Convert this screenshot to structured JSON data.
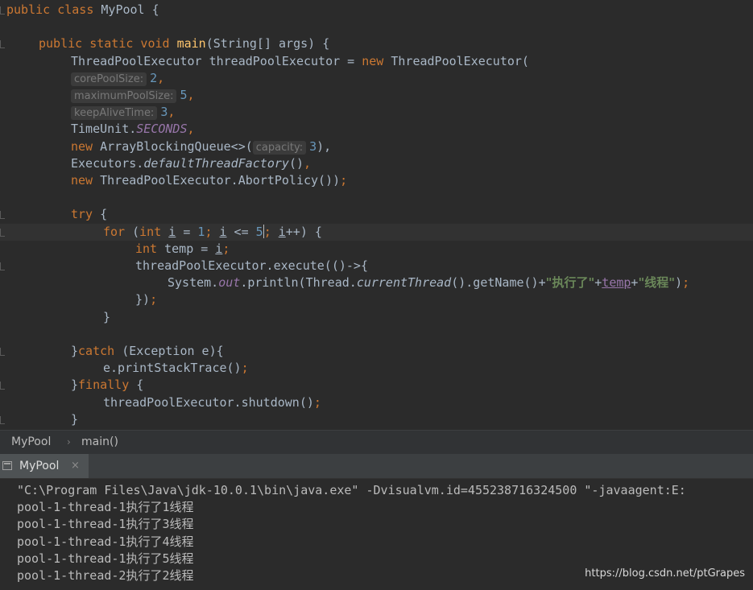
{
  "breadcrumb": {
    "class_name": "MyPool",
    "method_name": "main()"
  },
  "run_tab": {
    "label": "MyPool",
    "close": "×"
  },
  "code_lines": [
    {
      "indent": 0,
      "tokens": [
        {
          "t": "public class ",
          "c": "kw"
        },
        {
          "t": "MyPool {",
          "c": ""
        }
      ]
    },
    {
      "indent": 0,
      "tokens": []
    },
    {
      "indent": 1,
      "tokens": [
        {
          "t": "public static void ",
          "c": "kw"
        },
        {
          "t": "main",
          "c": "fn"
        },
        {
          "t": "(String[] args) {",
          "c": ""
        }
      ]
    },
    {
      "indent": 2,
      "tokens": [
        {
          "t": "ThreadPoolExecutor threadPoolExecutor = ",
          "c": ""
        },
        {
          "t": "new ",
          "c": "kw"
        },
        {
          "t": "ThreadPoolExecutor(",
          "c": ""
        }
      ]
    },
    {
      "indent": 2,
      "tokens": [
        {
          "t": "corePoolSize:",
          "c": "hint"
        },
        {
          "t": "2",
          "c": "num"
        },
        {
          "t": ",",
          "c": "kw"
        }
      ]
    },
    {
      "indent": 2,
      "tokens": [
        {
          "t": "maximumPoolSize:",
          "c": "hint"
        },
        {
          "t": "5",
          "c": "num"
        },
        {
          "t": ",",
          "c": "kw"
        }
      ]
    },
    {
      "indent": 2,
      "tokens": [
        {
          "t": "keepAliveTime:",
          "c": "hint"
        },
        {
          "t": "3",
          "c": "num"
        },
        {
          "t": ",",
          "c": "kw"
        }
      ]
    },
    {
      "indent": 2,
      "tokens": [
        {
          "t": "TimeUnit.",
          "c": ""
        },
        {
          "t": "SECONDS",
          "c": "stat"
        },
        {
          "t": ",",
          "c": "kw"
        }
      ]
    },
    {
      "indent": 2,
      "tokens": [
        {
          "t": "new ",
          "c": "kw"
        },
        {
          "t": "ArrayBlockingQueue<>(",
          "c": ""
        },
        {
          "t": "capacity:",
          "c": "hint"
        },
        {
          "t": "3",
          "c": "num"
        },
        {
          "t": "),",
          "c": ""
        }
      ]
    },
    {
      "indent": 2,
      "tokens": [
        {
          "t": "Executors.",
          "c": ""
        },
        {
          "t": "defaultThreadFactory",
          "c": "ital"
        },
        {
          "t": "()",
          "c": ""
        },
        {
          "t": ",",
          "c": "kw"
        }
      ]
    },
    {
      "indent": 2,
      "tokens": [
        {
          "t": "new ",
          "c": "kw"
        },
        {
          "t": "ThreadPoolExecutor.AbortPolicy())",
          "c": ""
        },
        {
          "t": ";",
          "c": "kw"
        }
      ]
    },
    {
      "indent": 0,
      "tokens": []
    },
    {
      "indent": 2,
      "tokens": [
        {
          "t": "try ",
          "c": "kw"
        },
        {
          "t": "{",
          "c": ""
        }
      ]
    },
    {
      "indent": 3,
      "tokens": [
        {
          "t": "for ",
          "c": "kw"
        },
        {
          "t": "(",
          "c": ""
        },
        {
          "t": "int ",
          "c": "kw"
        },
        {
          "t": "i",
          "c": "var-u"
        },
        {
          "t": " = ",
          "c": ""
        },
        {
          "t": "1",
          "c": "num"
        },
        {
          "t": "; ",
          "c": "kw"
        },
        {
          "t": "i",
          "c": "var-u"
        },
        {
          "t": " <= ",
          "c": ""
        },
        {
          "t": "5",
          "c": "num"
        },
        {
          "t": "",
          "c": "caret"
        },
        {
          "t": "; ",
          "c": "kw"
        },
        {
          "t": "i",
          "c": "var-u"
        },
        {
          "t": "++) {",
          "c": ""
        }
      ]
    },
    {
      "indent": 4,
      "tokens": [
        {
          "t": "int ",
          "c": "kw"
        },
        {
          "t": "temp = ",
          "c": ""
        },
        {
          "t": "i",
          "c": "var-u"
        },
        {
          "t": ";",
          "c": "kw"
        }
      ]
    },
    {
      "indent": 4,
      "tokens": [
        {
          "t": "threadPoolExecutor.execute(()->{",
          "c": ""
        }
      ]
    },
    {
      "indent": 5,
      "tokens": [
        {
          "t": "System.",
          "c": ""
        },
        {
          "t": "out",
          "c": "stat"
        },
        {
          "t": ".println(Thread.",
          "c": ""
        },
        {
          "t": "currentThread",
          "c": "ital"
        },
        {
          "t": "().getName()+",
          "c": ""
        },
        {
          "t": "\"执行了\"",
          "c": "str"
        },
        {
          "t": "+",
          "c": ""
        },
        {
          "t": "temp",
          "c": "field-u"
        },
        {
          "t": "+",
          "c": ""
        },
        {
          "t": "\"线程\"",
          "c": "str"
        },
        {
          "t": ")",
          "c": ""
        },
        {
          "t": ";",
          "c": "kw"
        }
      ]
    },
    {
      "indent": 4,
      "tokens": [
        {
          "t": "})",
          "c": ""
        },
        {
          "t": ";",
          "c": "kw"
        }
      ]
    },
    {
      "indent": 3,
      "tokens": [
        {
          "t": "}",
          "c": ""
        }
      ]
    },
    {
      "indent": 0,
      "tokens": []
    },
    {
      "indent": 2,
      "tokens": [
        {
          "t": "}",
          "c": ""
        },
        {
          "t": "catch ",
          "c": "kw"
        },
        {
          "t": "(Exception e){",
          "c": ""
        }
      ]
    },
    {
      "indent": 3,
      "tokens": [
        {
          "t": "e.printStackTrace()",
          "c": ""
        },
        {
          "t": ";",
          "c": "kw"
        }
      ]
    },
    {
      "indent": 2,
      "tokens": [
        {
          "t": "}",
          "c": ""
        },
        {
          "t": "finally ",
          "c": "kw"
        },
        {
          "t": "{",
          "c": ""
        }
      ]
    },
    {
      "indent": 3,
      "tokens": [
        {
          "t": "threadPoolExecutor.shutdown()",
          "c": ""
        },
        {
          "t": ";",
          "c": "kw"
        }
      ]
    },
    {
      "indent": 2,
      "tokens": [
        {
          "t": "}",
          "c": ""
        }
      ]
    }
  ],
  "console_lines": [
    "\"C:\\Program Files\\Java\\jdk-10.0.1\\bin\\java.exe\" -Dvisualvm.id=455238716324500 \"-javaagent:E:",
    "pool-1-thread-1执行了1线程",
    "pool-1-thread-1执行了3线程",
    "pool-1-thread-1执行了4线程",
    "pool-1-thread-1执行了5线程",
    "pool-1-thread-2执行了2线程"
  ],
  "watermark": "https://blog.csdn.net/ptGrapes"
}
